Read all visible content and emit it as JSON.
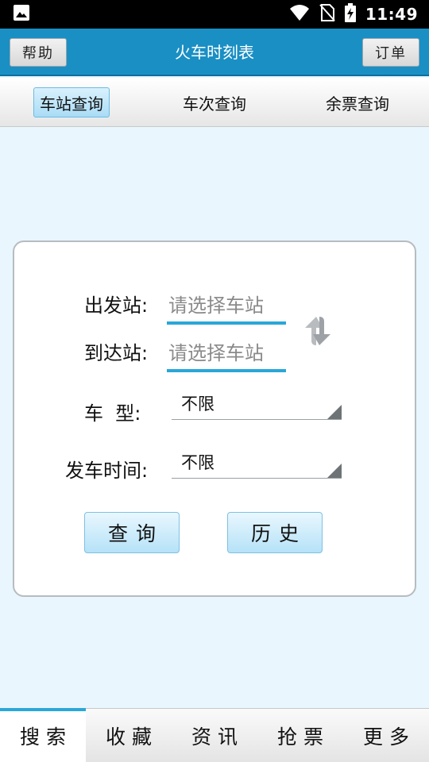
{
  "status_bar": {
    "time": "11:49"
  },
  "header": {
    "title": "火车时刻表",
    "help_label": "帮助",
    "orders_label": "订单"
  },
  "tabs": [
    {
      "label": "车站查询",
      "active": true
    },
    {
      "label": "车次查询",
      "active": false
    },
    {
      "label": "余票查询",
      "active": false
    }
  ],
  "form": {
    "departure_label": "出发站:",
    "departure_placeholder": "请选择车站",
    "arrival_label": "到达站:",
    "arrival_placeholder": "请选择车站",
    "train_type_label": "车  型:",
    "train_type_value": "不限",
    "depart_time_label": "发车时间:",
    "depart_time_value": "不限",
    "query_label": "查询",
    "history_label": "历史"
  },
  "bottom_nav": [
    {
      "label": "搜索",
      "active": true
    },
    {
      "label": "收藏",
      "active": false
    },
    {
      "label": "资讯",
      "active": false
    },
    {
      "label": "抢票",
      "active": false
    },
    {
      "label": "更多",
      "active": false
    }
  ],
  "colors": {
    "accent": "#1a8fc4",
    "input_underline": "#2aa7d8",
    "background": "#e9f6fd"
  }
}
